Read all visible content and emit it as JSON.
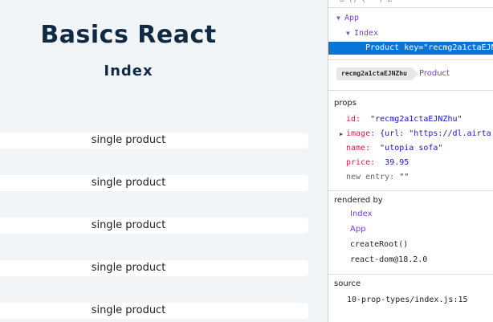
{
  "app": {
    "title": "Basics React",
    "subtitle": "Index",
    "products": [
      {
        "label": "single product"
      },
      {
        "label": "single product"
      },
      {
        "label": "single product"
      },
      {
        "label": "single product"
      },
      {
        "label": "single product"
      }
    ]
  },
  "devtools": {
    "top_clip": "…  ()  ( ·  )  …",
    "tree": {
      "app": "App",
      "index": "Index",
      "product": "Product",
      "product_key_attr": "key=",
      "product_key_value": "\"recmg2a1ctaEJN"
    },
    "selected": {
      "key_badge": "recmg2a1ctaEJNZhu",
      "component": "Product"
    },
    "props": {
      "title": "props",
      "rows": [
        {
          "key": "id:",
          "value": "\"recmg2a1ctaEJNZhu\""
        },
        {
          "key": "image:",
          "value": "{url: \"https://dl.airta"
        },
        {
          "key": "name:",
          "value": "\"utopia sofa\""
        },
        {
          "key": "price:",
          "value": "39.95"
        },
        {
          "key": "new entry:",
          "value": "\"\""
        }
      ]
    },
    "rendered_by": {
      "title": "rendered by",
      "owners": [
        "Index",
        "App",
        "createRoot()",
        "react-dom@18.2.0"
      ]
    },
    "source": {
      "title": "source",
      "file": "10-prop-types/index.js:15"
    },
    "colors": {
      "selection": "#0a74d9",
      "component": "#6f42c1",
      "prop_key": "#c7254e",
      "prop_value": "#1a1aa6"
    },
    "icons": [
      "caret-down-icon",
      "caret-right-icon"
    ]
  }
}
